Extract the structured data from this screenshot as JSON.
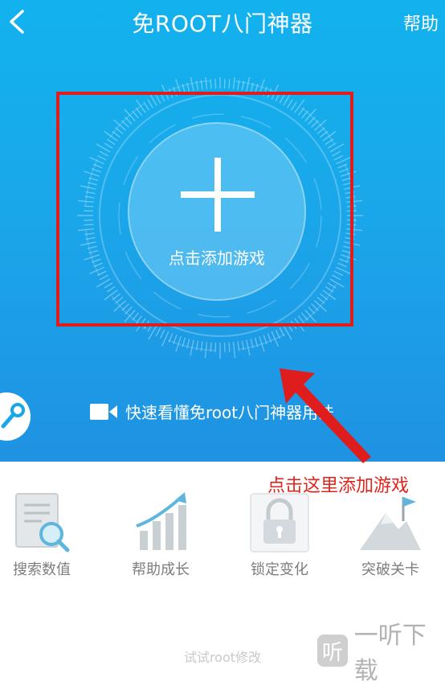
{
  "header": {
    "title": "免ROOT八门神器",
    "help_label": "帮助"
  },
  "main": {
    "add_game_label": "点击添加游戏",
    "video_link": "快速看懂免root八门神器用法"
  },
  "annotation": {
    "text": "点击这里添加游戏",
    "color": "#e0241c"
  },
  "features": [
    {
      "label": "搜索数值",
      "icon": "search-document-icon"
    },
    {
      "label": "帮助成长",
      "icon": "growth-chart-icon"
    },
    {
      "label": "锁定变化",
      "icon": "lock-icon"
    },
    {
      "label": "突破关卡",
      "icon": "mountain-flag-icon"
    }
  ],
  "footer": {
    "text": "试试root修改"
  },
  "watermark": {
    "logo_char": "听",
    "text": "一听下载"
  },
  "colors": {
    "primary_blue": "#16a9ec",
    "highlight_red": "#e01d1d",
    "feature_gray": "#7d7d7d"
  }
}
